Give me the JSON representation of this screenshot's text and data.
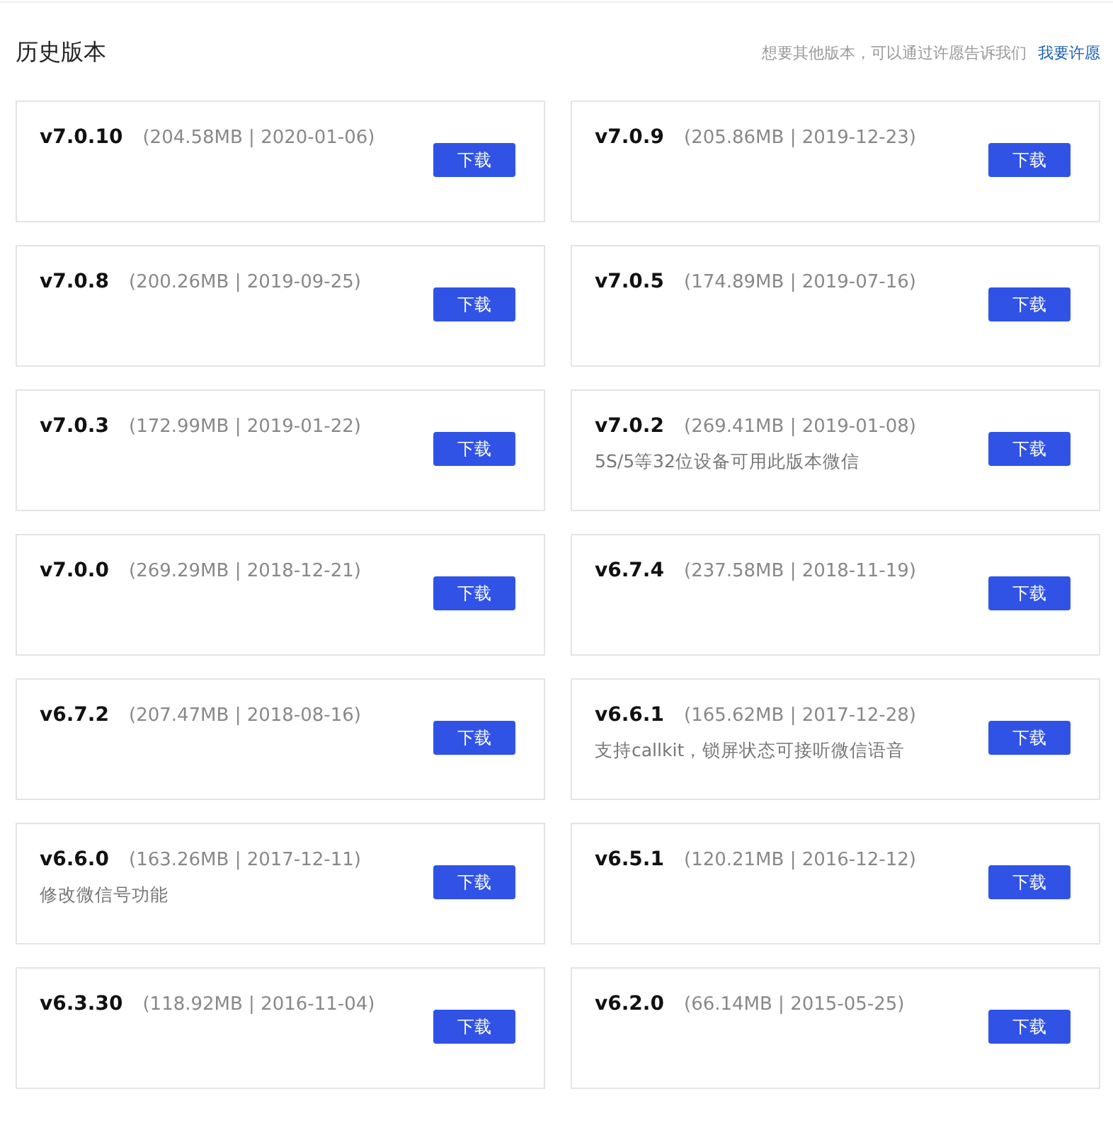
{
  "title": "历史版本",
  "wish": {
    "text": "想要其他版本，可以通过许愿告诉我们",
    "link": "我要许愿"
  },
  "versions": [
    {
      "version": "v7.0.10",
      "info": "(204.58MB | 2020-01-06)",
      "button": "下载"
    },
    {
      "version": "v7.0.9",
      "info": "(205.86MB | 2019-12-23)",
      "button": "下载"
    },
    {
      "version": "v7.0.8",
      "info": "(200.26MB | 2019-09-25)",
      "button": "下载"
    },
    {
      "version": "v7.0.5",
      "info": "(174.89MB | 2019-07-16)",
      "button": "下载"
    },
    {
      "version": "v7.0.3",
      "info": "(172.99MB | 2019-01-22)",
      "button": "下载"
    },
    {
      "version": "v7.0.2",
      "info": "(269.41MB | 2019-01-08)",
      "note": "5S/5等32位设备可用此版本微信",
      "button": "下载"
    },
    {
      "version": "v7.0.0",
      "info": "(269.29MB | 2018-12-21)",
      "button": "下载"
    },
    {
      "version": "v6.7.4",
      "info": "(237.58MB | 2018-11-19)",
      "button": "下载"
    },
    {
      "version": "v6.7.2",
      "info": "(207.47MB | 2018-08-16)",
      "button": "下载"
    },
    {
      "version": "v6.6.1",
      "info": "(165.62MB | 2017-12-28)",
      "note": "支持callkit，锁屏状态可接听微信语音",
      "button": "下载"
    },
    {
      "version": "v6.6.0",
      "info": "(163.26MB | 2017-12-11)",
      "note": "修改微信号功能",
      "button": "下载"
    },
    {
      "version": "v6.5.1",
      "info": "(120.21MB | 2016-12-12)",
      "button": "下载"
    },
    {
      "version": "v6.3.30",
      "info": "(118.92MB | 2016-11-04)",
      "button": "下载"
    },
    {
      "version": "v6.2.0",
      "info": "(66.14MB | 2015-05-25)",
      "button": "下载"
    }
  ]
}
